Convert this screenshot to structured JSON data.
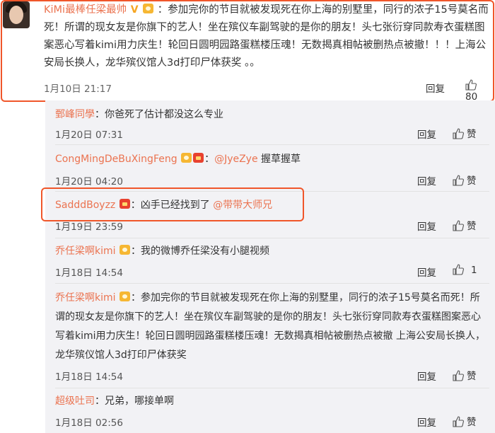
{
  "main_comment": {
    "username": "KiMi最棒任梁最帅",
    "text": "：参加完你的节目就被发现死在你上海的别墅里，同行的浓子15号莫名而死！所谓的现女友是你旗下的艺人！坐在殡仪车副驾驶的是你的朋友！头七张衍穿同款寿衣蛋糕图案恶心写着kimi用力庆生！轮回日圆明园路蛋糕楼压魂！无数揭真相帖被删热点被撤！！！上海公安局长换人，龙华殡仪馆人3d打印尸体获奖 。。",
    "time": "1月10日 21:17",
    "reply_label": "回复",
    "like_count": "80"
  },
  "replies": [
    {
      "username": "鄄峰同學",
      "text": "：你爸死了估计都没这么专业",
      "time": "1月20日 07:31",
      "reply_label": "回复",
      "like_label": "赞"
    },
    {
      "username": "CongMingDeBuXingFeng",
      "text": "：",
      "mention": "@JyeZye",
      "text_after": " 握草握草",
      "time": "1月20日 04:20",
      "reply_label": "回复",
      "like_label": "赞"
    },
    {
      "username": "SadddBoyzz",
      "text": "：凶手已经找到了 ",
      "mention": "@带带大师兄",
      "time": "1月19日 23:59",
      "reply_label": "回复",
      "like_label": "赞"
    },
    {
      "username": "乔任梁啊kimi",
      "text": "：我的微博乔任梁没有小腿视频",
      "time": "1月18日 14:54",
      "reply_label": "回复",
      "like_label": "1"
    },
    {
      "username": "乔任梁啊kimi",
      "text": "：参加完你的节目就被发现死在你上海的别墅里，同行的浓子15号莫名而死！所谓的现女友是你旗下的艺人！坐在殡仪车副驾驶的是你的朋友！头七张衍穿同款寿衣蛋糕图案恶心写着kimi用力庆生！轮回日圆明园路蛋糕楼压魂！无数揭真相帖被删热点被撤 上海公安局长换人，龙华殡仪馆人3d打印尸体获奖",
      "time": "1月18日 14:54",
      "reply_label": "回复",
      "like_label": "赞"
    },
    {
      "username": "超级吐司",
      "text": "：兄弟，哪接单啊",
      "time": "1月18日 02:56",
      "reply_label": "回复",
      "like_label": "赞"
    }
  ],
  "colors": {
    "username": "#eb7350",
    "highlight": "#f0562a",
    "panel": "#f2f2f5"
  }
}
